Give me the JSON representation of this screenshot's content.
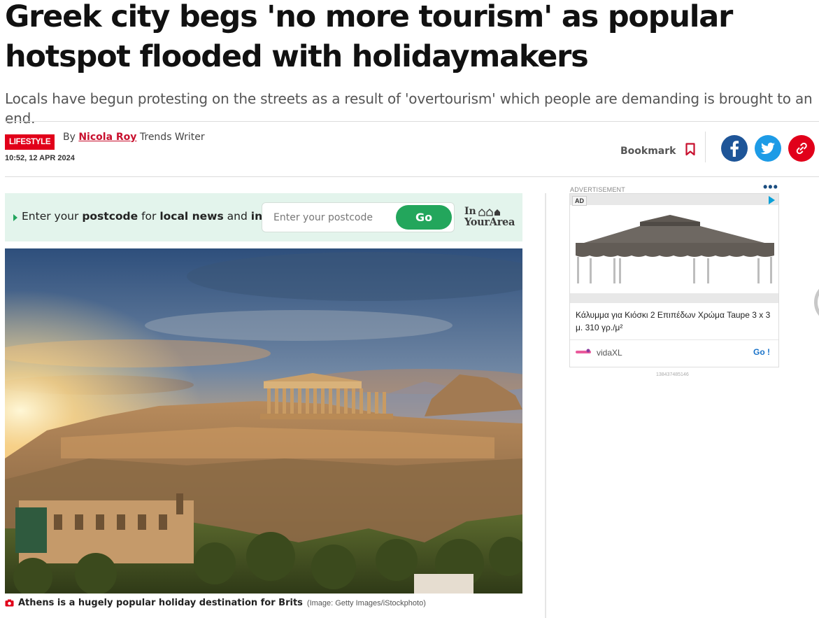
{
  "article": {
    "headline": "Greek city begs 'no more tourism' as popular hotspot flooded with holidaymakers",
    "standfirst": "Locals have begun protesting on the streets as a result of 'overtourism' which people are demanding is brought to an end.",
    "section": "LIFESTYLE",
    "by_prefix": "By",
    "author": "Nicola Roy",
    "author_role": "Trends Writer",
    "timestamp": "10:52, 12 APR 2024",
    "bookmark_label": "Bookmark"
  },
  "share": {
    "facebook_color": "#1e5598",
    "twitter_color": "#1d9be6",
    "link_color": "#e1001a"
  },
  "postcode_widget": {
    "prompt_1": "Enter your ",
    "prompt_bold_1": "postcode",
    "prompt_2": " for ",
    "prompt_bold_2": "local news",
    "prompt_3": " and ",
    "prompt_bold_3": "info",
    "input_placeholder": "Enter your postcode",
    "go_label": "Go",
    "logo_line1": "In",
    "logo_line2": "YourArea"
  },
  "hero": {
    "caption": "Athens is a hugely popular holiday destination for Brits",
    "credit": "(Image: Getty Images/iStockphoto)"
  },
  "advert": {
    "label": "ADVERTISEMENT",
    "badge": "AD",
    "title": "Κάλυμμα για Κιόσκι 2 Επιπέδων Χρώμα Taupe 3 x 3 μ. 310 γρ./μ²",
    "brand": "vidaXL",
    "cta": "Go !",
    "id": "138437485146"
  }
}
